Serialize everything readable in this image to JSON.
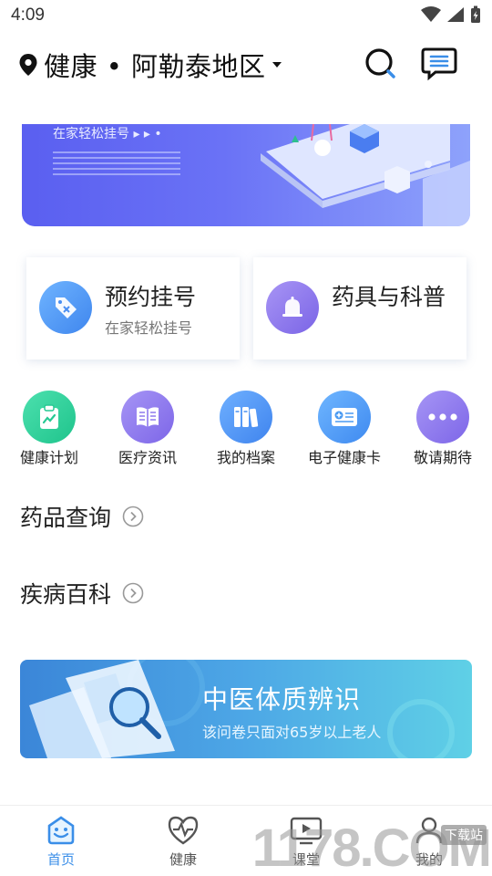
{
  "status": {
    "time": "4:09"
  },
  "header": {
    "location": "健康 • 阿勒泰地区"
  },
  "banner": {
    "caption": "在家轻松挂号 ▸ ▸ •"
  },
  "cards": [
    {
      "title": "预约挂号",
      "subtitle": "在家轻松挂号",
      "icon": "tag-icon",
      "color": "#4a8ff2"
    },
    {
      "title": "药具与科普",
      "subtitle": "",
      "icon": "bell-icon",
      "color": "#8a78ec"
    }
  ],
  "quick_links": [
    {
      "label": "健康计划",
      "icon": "clipboard-chart-icon",
      "color": "#2dd39b"
    },
    {
      "label": "医疗资讯",
      "icon": "book-icon",
      "color": "#8d78ee"
    },
    {
      "label": "我的档案",
      "icon": "folders-icon",
      "color": "#4a90f0"
    },
    {
      "label": "电子健康卡",
      "icon": "health-card-icon",
      "color": "#4a9af2"
    },
    {
      "label": "敬请期待",
      "icon": "more-icon",
      "color": "#8d78ee"
    }
  ],
  "sections": [
    {
      "title": "药品查询"
    },
    {
      "title": "疾病百科"
    }
  ],
  "promo": {
    "title": "中医体质辨识",
    "subtitle": "该问卷只面对65岁以上老人"
  },
  "bottom_nav": [
    {
      "label": "首页",
      "icon": "smile-home-icon",
      "active": true
    },
    {
      "label": "健康",
      "icon": "heartbeat-icon",
      "active": false
    },
    {
      "label": "课堂",
      "icon": "video-class-icon",
      "active": false
    },
    {
      "label": "我的",
      "icon": "user-icon",
      "active": false
    }
  ],
  "colors": {
    "accent": "#3a8ee8",
    "nav_inactive": "#555555"
  }
}
